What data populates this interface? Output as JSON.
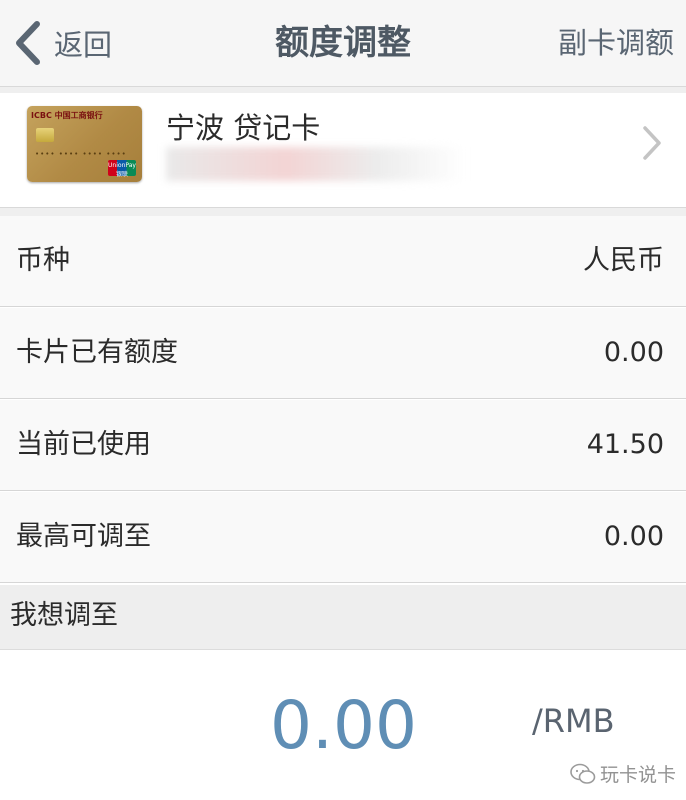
{
  "nav": {
    "back_label": "返回",
    "title": "额度调整",
    "right_link": "副卡调额"
  },
  "card": {
    "name": "宁波 贷记卡",
    "bank_logo_text": "ICBC 中国工商银行",
    "network_logo_text": "UnionPay 银联",
    "number_visible": false
  },
  "rows": [
    {
      "label": "币种",
      "value": "人民币"
    },
    {
      "label": "卡片已有额度",
      "value": "0.00"
    },
    {
      "label": "当前已使用",
      "value": "41.50"
    },
    {
      "label": "最高可调至",
      "value": "0.00"
    }
  ],
  "section": {
    "label": "我想调至"
  },
  "amount": {
    "value": "0.00",
    "unit": "/RMB"
  },
  "watermark": {
    "text": "玩卡说卡"
  },
  "colors": {
    "nav_text": "#5a6673",
    "title_text": "#4e5964",
    "amount_text": "#5f8eb5",
    "row_background": "#f9f9f9",
    "section_background": "#eeeeee"
  },
  "icons": [
    "back-chevron-icon",
    "chevron-right-icon",
    "wechat-icon"
  ]
}
